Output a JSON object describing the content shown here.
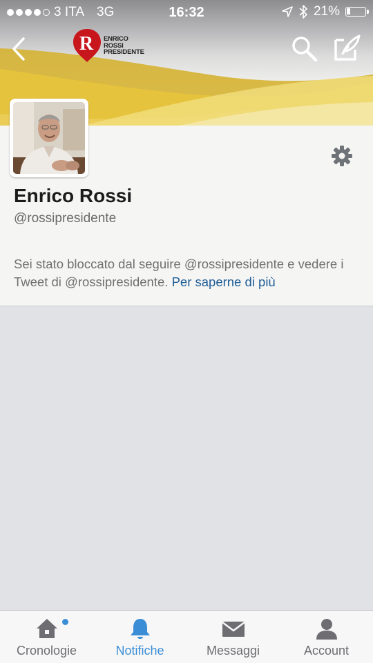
{
  "status_bar": {
    "carrier": "3 ITA",
    "network": "3G",
    "time": "16:32",
    "battery": "21%",
    "battery_level": 0.21
  },
  "header": {
    "logo_lines": [
      "ENRICO",
      "ROSSI",
      "PRESIDENTE"
    ],
    "logo_letter": "R"
  },
  "profile": {
    "name": "Enrico Rossi",
    "handle": "@rossipresidente"
  },
  "blocked_notice": {
    "text": "Sei stato bloccato dal seguire @rossipresidente e vedere i Tweet di @rossipresidente.",
    "link": "Per saperne di più"
  },
  "tabs": [
    {
      "label": "Cronologie",
      "icon": "home-icon",
      "badge": true
    },
    {
      "label": "Notifiche",
      "icon": "bell-icon",
      "active": true
    },
    {
      "label": "Messaggi",
      "icon": "envelope-icon"
    },
    {
      "label": "Account",
      "icon": "person-icon"
    }
  ],
  "colors": {
    "accent": "#3b8ed6",
    "link": "#1f5d96",
    "logo_red": "#c8161d",
    "banner_yellow": "#e8c23a"
  }
}
